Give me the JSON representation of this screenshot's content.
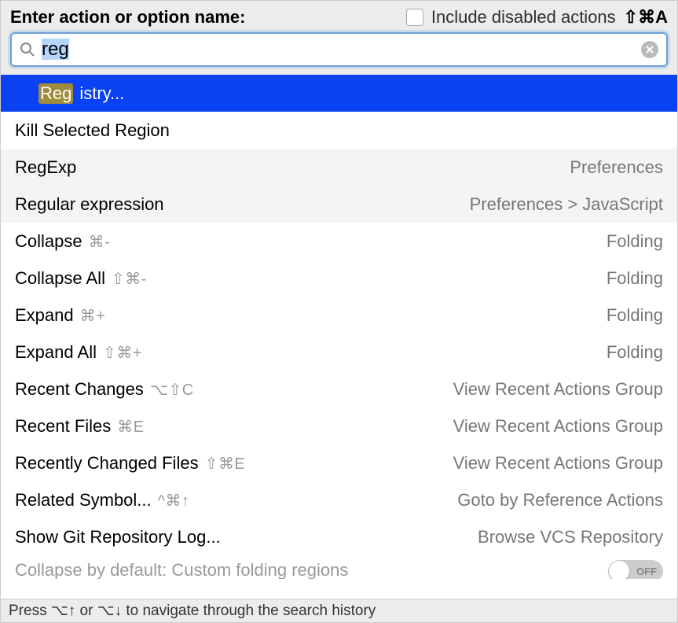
{
  "header": {
    "prompt": "Enter action or option name:",
    "include_label": "Include disabled actions",
    "include_shortcut": "⇧⌘A"
  },
  "search": {
    "value": "reg"
  },
  "results": [
    {
      "label_pre": "Reg",
      "label_post": "istry...",
      "shortcut": "",
      "group": "",
      "selected": true,
      "shaded": false
    },
    {
      "label": "Kill Selected Region",
      "shortcut": "",
      "group": "",
      "shaded": false
    },
    {
      "label": "RegExp",
      "shortcut": "",
      "group": "Preferences",
      "shaded": true
    },
    {
      "label": "Regular expression",
      "shortcut": "",
      "group": "Preferences > JavaScript",
      "shaded": true
    },
    {
      "label": "Collapse",
      "shortcut": "⌘-",
      "group": "Folding",
      "shaded": false
    },
    {
      "label": "Collapse All",
      "shortcut": "⇧⌘-",
      "group": "Folding",
      "shaded": false
    },
    {
      "label": "Expand",
      "shortcut": "⌘+",
      "group": "Folding",
      "shaded": false
    },
    {
      "label": "Expand All",
      "shortcut": "⇧⌘+",
      "group": "Folding",
      "shaded": false
    },
    {
      "label": "Recent Changes",
      "shortcut": "⌥⇧C",
      "group": "View Recent Actions Group",
      "shaded": false
    },
    {
      "label": "Recent Files",
      "shortcut": "⌘E",
      "group": "View Recent Actions Group",
      "shaded": false
    },
    {
      "label": "Recently Changed Files",
      "shortcut": "⇧⌘E",
      "group": "View Recent Actions Group",
      "shaded": false
    },
    {
      "label": "Related Symbol...",
      "shortcut": "^⌘↑",
      "group": "Goto by Reference Actions",
      "shaded": false
    },
    {
      "label": "Show Git Repository Log...",
      "shortcut": "",
      "group": "Browse VCS Repository",
      "shaded": false
    },
    {
      "label": "Collapse by default: Custom folding regions",
      "shortcut": "",
      "group": "",
      "toggle": "OFF",
      "shaded": false,
      "cutoff": true
    }
  ],
  "footer": {
    "hint": "Press ⌥↑ or ⌥↓ to navigate through the search history"
  }
}
